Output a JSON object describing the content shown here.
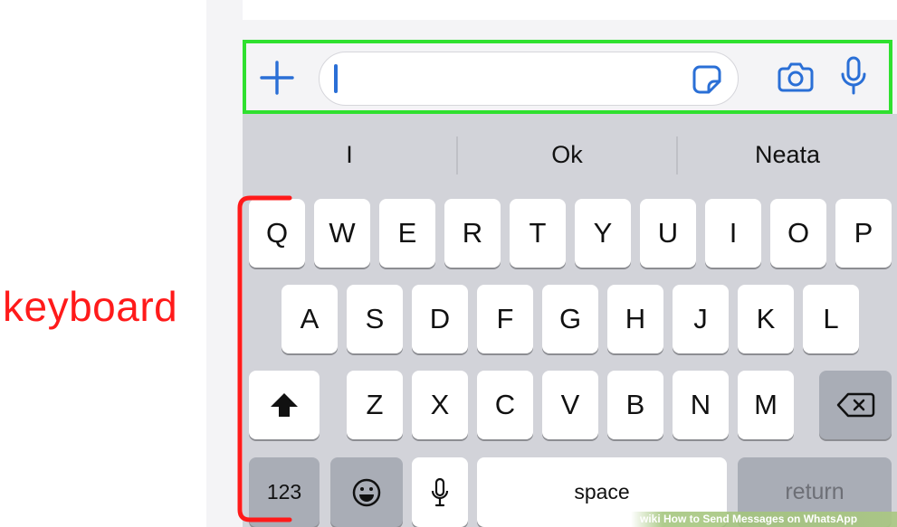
{
  "annotation": {
    "label": "keyboard",
    "color": "#ff1a1a"
  },
  "composer": {
    "highlight_color": "#2fe02f",
    "attach_icon": "plus-icon",
    "sticker_icon": "sticker-icon",
    "camera_icon": "camera-icon",
    "mic_icon": "microphone-icon",
    "field_value": ""
  },
  "suggestions": [
    "I",
    "Ok",
    "Neata"
  ],
  "keyboard": {
    "row1": [
      "Q",
      "W",
      "E",
      "R",
      "T",
      "Y",
      "U",
      "I",
      "O",
      "P"
    ],
    "row2": [
      "A",
      "S",
      "D",
      "F",
      "G",
      "H",
      "J",
      "K",
      "L"
    ],
    "row3": [
      "Z",
      "X",
      "C",
      "V",
      "B",
      "N",
      "M"
    ],
    "shift_icon": "shift-icon",
    "delete_icon": "backspace-icon",
    "numbers_label": "123",
    "emoji_icon": "emoji-icon",
    "dictation_icon": "microphone-icon",
    "space_label": "space",
    "return_label": "return"
  },
  "watermark": "wiki How to Send Messages on WhatsApp"
}
